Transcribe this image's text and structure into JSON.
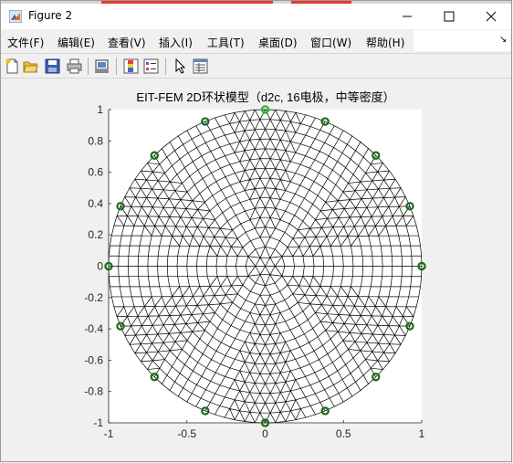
{
  "window": {
    "title": "Figure 2"
  },
  "menu": [
    "文件(F)",
    "编辑(E)",
    "查看(V)",
    "插入(I)",
    "工具(T)",
    "桌面(D)",
    "窗口(W)",
    "帮助(H)"
  ],
  "menu_overflow_arrow": "↘",
  "toolbar": [
    "new-figure-icon",
    "open-file-icon",
    "save-icon",
    "print-icon",
    "link-plot-icon",
    "insert-colorbar-icon",
    "insert-legend-icon",
    "edit-plot-pointer-icon",
    "property-inspector-icon"
  ],
  "colors": {
    "electrode": "#1a6b1a",
    "first_electrode": "#2db52d",
    "mesh": "#000000",
    "axes_bg": "#ffffff"
  },
  "chart_data": {
    "type": "mesh",
    "title": "EIT-FEM 2D环状模型（d2c, 16电极，中等密度）",
    "xlabel": "",
    "ylabel": "",
    "xlim": [
      -1,
      1
    ],
    "ylim": [
      -1,
      1
    ],
    "xticks": [
      "-1",
      "-0.5",
      "0",
      "0.5",
      "1"
    ],
    "yticks": [
      "1",
      "0.8",
      "0.6",
      "0.4",
      "0.2",
      "0",
      "-0.2",
      "-0.4",
      "-0.6",
      "-0.8",
      "-1"
    ],
    "electrodes": [
      {
        "x": 0,
        "y": 1
      },
      {
        "x": 0.383,
        "y": 0.924
      },
      {
        "x": 0.707,
        "y": 0.707
      },
      {
        "x": 0.924,
        "y": 0.383
      },
      {
        "x": 1,
        "y": 0
      },
      {
        "x": 0.924,
        "y": -0.383
      },
      {
        "x": 0.707,
        "y": -0.707
      },
      {
        "x": 0.383,
        "y": -0.924
      },
      {
        "x": 0,
        "y": -1
      },
      {
        "x": -0.383,
        "y": -0.924
      },
      {
        "x": -0.707,
        "y": -0.707
      },
      {
        "x": -0.924,
        "y": -0.383
      },
      {
        "x": -1,
        "y": 0
      },
      {
        "x": -0.924,
        "y": 0.383
      },
      {
        "x": -0.707,
        "y": 0.707
      },
      {
        "x": -0.383,
        "y": 0.924
      }
    ],
    "mesh_rings": 16,
    "grid": false
  }
}
